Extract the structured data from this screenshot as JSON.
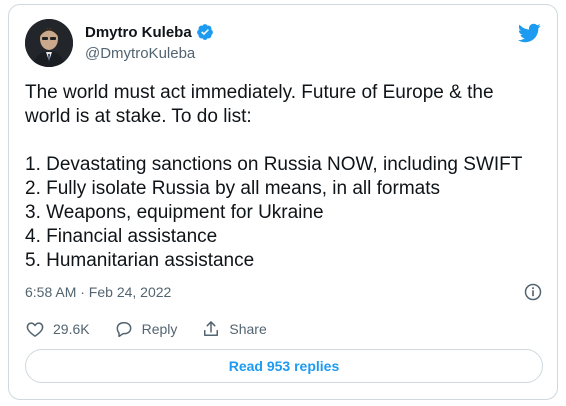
{
  "author": {
    "display_name": "Dmytro Kuleba",
    "handle": "@DmytroKuleba",
    "verified": true
  },
  "tweet": {
    "lines": [
      "The world must act immediately. Future of Europe & the",
      "world is at stake. To do list:",
      "",
      "1. Devastating sanctions on Russia NOW, including SWIFT",
      "2. Fully isolate Russia by all means, in all formats",
      "3. Weapons, equipment for Ukraine",
      "4. Financial assistance",
      "5. Humanitarian assistance"
    ],
    "timestamp": "6:58 AM · Feb 24, 2022"
  },
  "actions": {
    "like_count": "29.6K",
    "reply_label": "Reply",
    "share_label": "Share"
  },
  "replies_button": {
    "label": "Read 953 replies"
  },
  "colors": {
    "accent": "#1d9bf0",
    "text": "#0f1419",
    "secondary_text": "#536471",
    "border": "#cfd9de"
  },
  "icons": [
    "avatar",
    "verified-badge-icon",
    "twitter-bird-icon",
    "info-icon",
    "heart-icon",
    "reply-icon",
    "share-icon"
  ]
}
